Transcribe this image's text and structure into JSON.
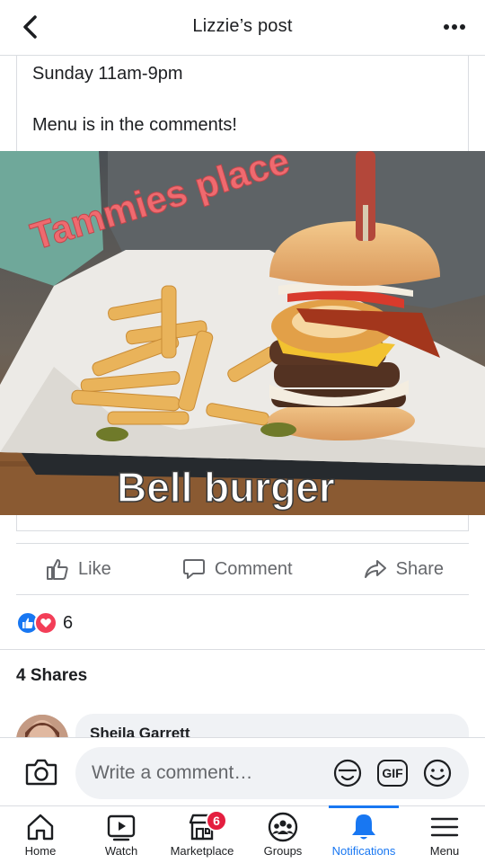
{
  "header": {
    "title": "Lizzie’s post",
    "back_icon": "chevron-left-icon",
    "more_icon": "more-horizontal-icon"
  },
  "post": {
    "hours_line": "Sunday 11am-9pm",
    "menu_line": "Menu is in the comments!",
    "photo_caption_top": "Tammies place",
    "photo_caption_bottom": "Bell burger"
  },
  "actions": {
    "like": "Like",
    "comment": "Comment",
    "share": "Share"
  },
  "reactions": {
    "count": "6",
    "types": [
      "like",
      "love"
    ],
    "like_color": "#1877f2",
    "love_color": "#f33e58"
  },
  "shares": {
    "label": "4 Shares"
  },
  "comment_preview": {
    "author": "Sheila Garrett"
  },
  "composer": {
    "placeholder": "Write a comment…",
    "camera_icon": "camera-icon",
    "sticker_icon": "sticker-icon",
    "gif_label": "GIF",
    "emoji_icon": "emoji-icon"
  },
  "nav": {
    "items": [
      {
        "label": "Home",
        "icon": "home-icon"
      },
      {
        "label": "Watch",
        "icon": "watch-icon"
      },
      {
        "label": "Marketplace",
        "icon": "marketplace-icon",
        "badge": "6"
      },
      {
        "label": "Groups",
        "icon": "groups-icon"
      },
      {
        "label": "Notifications",
        "icon": "bell-icon",
        "active": true
      },
      {
        "label": "Menu",
        "icon": "menu-icon"
      }
    ],
    "accent": "#1877f2",
    "badge_color": "#e41e3f"
  }
}
